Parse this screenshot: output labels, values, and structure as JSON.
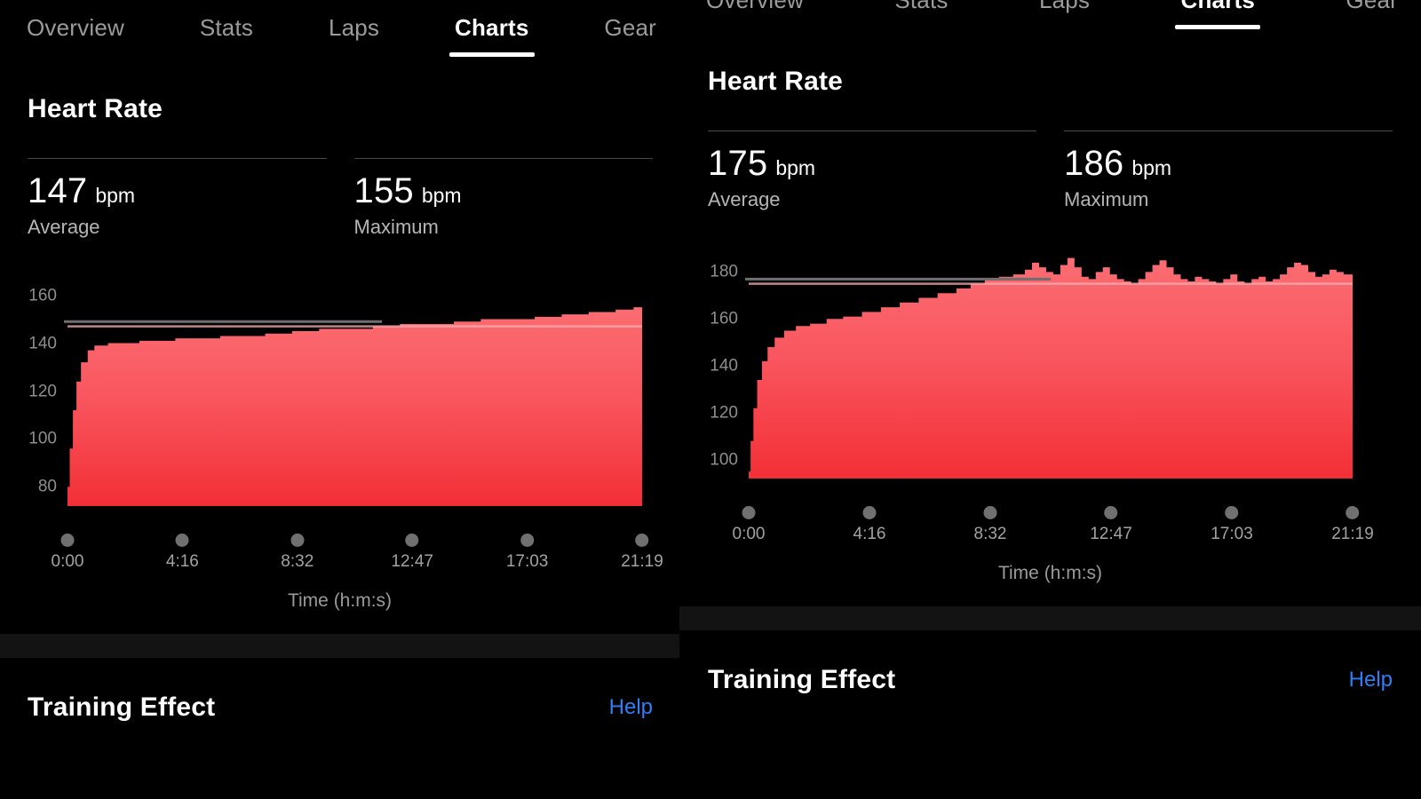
{
  "theme": {
    "background": "#000000",
    "accent_red": "#f4515a",
    "link_blue": "#2f7ef5",
    "muted_text": "#9b9b9b",
    "separator_band": "#131313"
  },
  "panels": [
    {
      "id": "left",
      "tabs": [
        {
          "label": "Overview",
          "active": false
        },
        {
          "label": "Stats",
          "active": false
        },
        {
          "label": "Laps",
          "active": false
        },
        {
          "label": "Charts",
          "active": true
        },
        {
          "label": "Gear",
          "active": false
        }
      ],
      "section_title": "Heart Rate",
      "stats": [
        {
          "value": "147",
          "unit": "bpm",
          "label": "Average"
        },
        {
          "value": "155",
          "unit": "bpm",
          "label": "Maximum"
        }
      ],
      "training_effect": {
        "title": "Training Effect",
        "help_label": "Help"
      },
      "chart_data": {
        "type": "area",
        "title": "Heart Rate",
        "xlabel": "Time (h:m:s)",
        "ylabel": "",
        "xtick_labels": [
          "0:00",
          "4:16",
          "8:32",
          "12:47",
          "17:03",
          "21:19"
        ],
        "ytick_labels": [
          "160",
          "140",
          "120",
          "100",
          "80"
        ],
        "yticks": [
          160,
          140,
          120,
          100,
          80
        ],
        "ylim": [
          72,
          168
        ],
        "xlim": [
          0,
          1279
        ],
        "grid": false,
        "legend": false,
        "average_line": 147,
        "reference_line": 149,
        "series": [
          {
            "name": "Heart Rate",
            "unit": "bpm",
            "x": [
              0,
              5,
              12,
              20,
              30,
              45,
              60,
              90,
              120,
              160,
              200,
              240,
              290,
              340,
              390,
              440,
              500,
              560,
              620,
              680,
              740,
              800,
              860,
              920,
              980,
              1040,
              1100,
              1160,
              1220,
              1260,
              1279
            ],
            "values": [
              80,
              96,
              112,
              124,
              132,
              137,
              139,
              140,
              140,
              141,
              141,
              142,
              142,
              143,
              143,
              144,
              145,
              146,
              146,
              147,
              148,
              148,
              149,
              150,
              150,
              151,
              152,
              153,
              154,
              155,
              155
            ]
          }
        ]
      }
    },
    {
      "id": "right",
      "tabs": [
        {
          "label": "Overview",
          "active": false
        },
        {
          "label": "Stats",
          "active": false
        },
        {
          "label": "Laps",
          "active": false
        },
        {
          "label": "Charts",
          "active": true
        },
        {
          "label": "Gear",
          "active": false
        }
      ],
      "section_title": "Heart Rate",
      "stats": [
        {
          "value": "175",
          "unit": "bpm",
          "label": "Average"
        },
        {
          "value": "186",
          "unit": "bpm",
          "label": "Maximum"
        }
      ],
      "training_effect": {
        "title": "Training Effect",
        "help_label": "Help"
      },
      "chart_data": {
        "type": "area",
        "title": "Heart Rate",
        "xlabel": "Time (h:m:s)",
        "ylabel": "",
        "xtick_labels": [
          "0:00",
          "4:16",
          "8:32",
          "12:47",
          "17:03",
          "21:19"
        ],
        "ytick_labels": [
          "180",
          "160",
          "140",
          "120",
          "100"
        ],
        "yticks": [
          180,
          160,
          140,
          120,
          100
        ],
        "ylim": [
          92,
          190
        ],
        "xlim": [
          0,
          1279
        ],
        "grid": false,
        "legend": false,
        "average_line": 175,
        "reference_line": 177,
        "series": [
          {
            "name": "Heart Rate",
            "unit": "bpm",
            "x": [
              0,
              4,
              10,
              18,
              28,
              40,
              55,
              75,
              100,
              130,
              165,
              200,
              240,
              280,
              320,
              360,
              400,
              440,
              470,
              500,
              530,
              560,
              585,
              600,
              615,
              630,
              645,
              660,
              675,
              690,
              705,
              720,
              735,
              750,
              765,
              780,
              795,
              810,
              825,
              840,
              855,
              870,
              885,
              900,
              915,
              930,
              945,
              960,
              975,
              990,
              1005,
              1020,
              1035,
              1050,
              1065,
              1080,
              1095,
              1110,
              1125,
              1140,
              1155,
              1170,
              1185,
              1200,
              1215,
              1230,
              1245,
              1260,
              1270,
              1279
            ],
            "values": [
              95,
              108,
              122,
              134,
              142,
              148,
              152,
              155,
              157,
              158,
              160,
              161,
              163,
              165,
              167,
              169,
              171,
              173,
              175,
              177,
              178,
              179,
              181,
              184,
              182,
              180,
              179,
              183,
              186,
              182,
              178,
              177,
              180,
              182,
              179,
              177,
              176,
              175,
              177,
              180,
              183,
              185,
              182,
              179,
              177,
              176,
              178,
              177,
              176,
              175,
              177,
              179,
              176,
              175,
              177,
              178,
              176,
              177,
              179,
              182,
              184,
              183,
              180,
              178,
              179,
              181,
              180,
              179,
              179,
              179
            ]
          }
        ]
      }
    }
  ]
}
